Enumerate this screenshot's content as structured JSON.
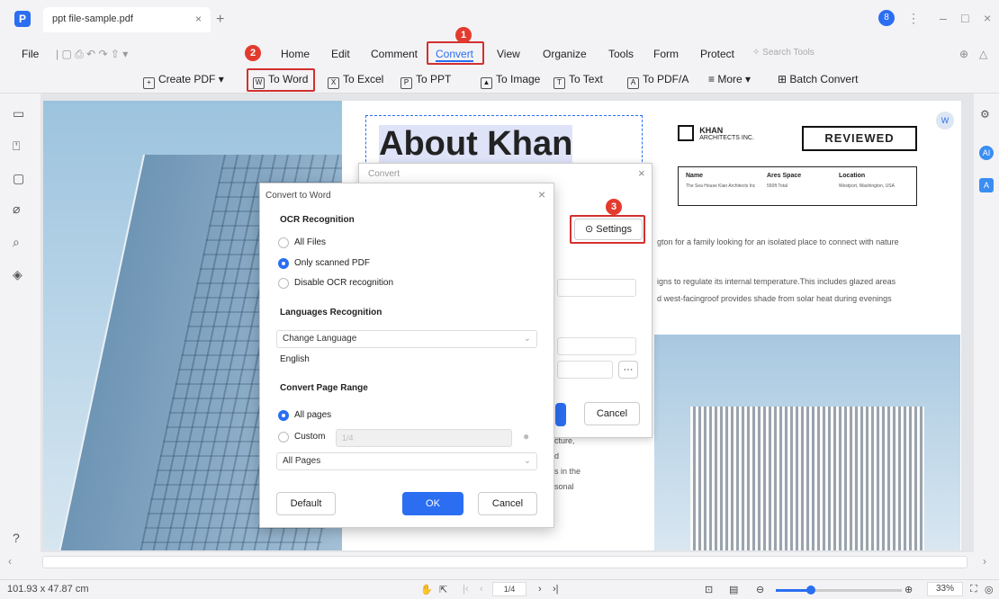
{
  "tab": {
    "file_name": "ppt file-sample.pdf",
    "close": "×",
    "new": "+"
  },
  "window_controls": {
    "avatar": "8",
    "more": "⋮",
    "minimize": "–",
    "maximize": "□",
    "close": "×"
  },
  "menu": {
    "file": "File",
    "items": [
      "Home",
      "Edit",
      "Comment",
      "Convert",
      "View",
      "Organize",
      "Tools",
      "Form",
      "Protect"
    ],
    "search_placeholder": "Search Tools"
  },
  "toolbar": {
    "create_pdf": "Create PDF",
    "to_word": "To Word",
    "to_excel": "To Excel",
    "to_ppt": "To PPT",
    "to_image": "To Image",
    "to_text": "To Text",
    "to_pdfa": "To PDF/A",
    "more": "More",
    "batch_convert": "Batch Convert"
  },
  "badges": {
    "b1": "1",
    "b2": "2",
    "b3": "3"
  },
  "document": {
    "heading": "About Khan",
    "brand_line1": "KHAN",
    "brand_line2": "ARCHITECTS INC.",
    "reviewed": "REVIEWED",
    "table": {
      "h1": "Name",
      "h2": "Ares Space",
      "h3": "Location",
      "v1": "The Sea House Kian Architects Inc",
      "v2": "550ft Total",
      "v3": "Westport, Washington, USA"
    },
    "para1": "gton for a family looking for an isolated place to connect with nature",
    "para2a": "igns to regulate its internal temperature.This includes glazed areas",
    "para2b": "d west-facingroof provides shade from solar heat during evenings",
    "frag1": "cture,",
    "frag2": "d",
    "frag3": "s in the",
    "frag4": "sonal"
  },
  "convert_dialog": {
    "title": "Convert",
    "settings": "Settings",
    "cancel": "Cancel",
    "more_btn": "···"
  },
  "word_dialog": {
    "title": "Convert to Word",
    "ocr_title": "OCR Recognition",
    "all_files": "All Files",
    "only_scanned": "Only scanned PDF",
    "disable_ocr": "Disable OCR recognition",
    "lang_title": "Languages Recognition",
    "change_language": "Change Language",
    "english": "English",
    "range_title": "Convert Page Range",
    "all_pages": "All pages",
    "custom": "Custom",
    "custom_placeholder": "1/4",
    "all_pages_select": "All Pages",
    "default": "Default",
    "ok": "OK",
    "cancel": "Cancel"
  },
  "status": {
    "dimensions": "101.93 x 47.87 cm",
    "page": "1/4",
    "zoom": "33%"
  }
}
